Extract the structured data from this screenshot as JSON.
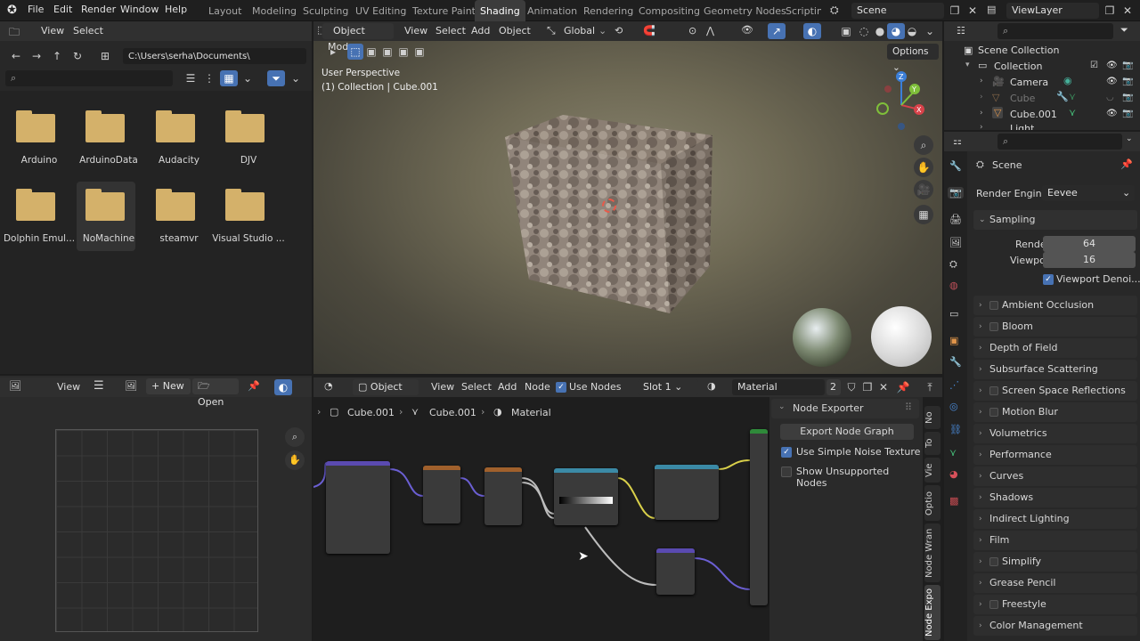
{
  "topbar": {
    "menus": [
      "File",
      "Edit",
      "Render",
      "Window",
      "Help"
    ],
    "workspaces": [
      "Layout",
      "Modeling",
      "Sculpting",
      "UV Editing",
      "Texture Paint",
      "Shading",
      "Animation",
      "Rendering",
      "Compositing",
      "Geometry Nodes",
      "Scripting"
    ],
    "active_workspace": "Shading",
    "scene": "Scene",
    "view_layer": "ViewLayer"
  },
  "file_browser": {
    "menus": [
      "View",
      "Select"
    ],
    "path": "C:\\Users\\serha\\Documents\\",
    "folders": [
      "Arduino",
      "ArduinoData",
      "Audacity",
      "DJV",
      "Dolphin Emul...",
      "NoMachine",
      "steamvr",
      "Visual Studio ..."
    ],
    "selected_folder": "NoMachine"
  },
  "viewport": {
    "mode": "Object Mode",
    "menus": [
      "View",
      "Select",
      "Add",
      "Object"
    ],
    "orientation": "Global",
    "options": "Options",
    "overlay_title": "User Perspective",
    "overlay_subtitle": "(1) Collection | Cube.001"
  },
  "image_editor": {
    "view": "View",
    "new": "New",
    "open": "Open"
  },
  "node_editor": {
    "object": "Object",
    "menus": [
      "View",
      "Select",
      "Add",
      "Node"
    ],
    "use_nodes": "Use Nodes",
    "slot": "Slot 1",
    "material": "Material",
    "users": "2",
    "breadcrumb": [
      "Cube.001",
      "Cube.001",
      "Material"
    ],
    "exporter": {
      "title": "Node Exporter",
      "export_button": "Export Node Graph",
      "simple_noise": "Use Simple Noise Texture",
      "show_unsupported": "Show Unsupported Nodes"
    },
    "side_tabs": [
      "No",
      "To",
      "Vie",
      "Optio",
      "Node Wran",
      "Node Expo"
    ]
  },
  "outliner": {
    "root": "Scene Collection",
    "collection": "Collection",
    "items": [
      "Camera",
      "Cube",
      "Cube.001",
      "Light"
    ]
  },
  "properties": {
    "scene": "Scene",
    "render_engine_label": "Render Engine",
    "render_engine": "Eevee",
    "sampling": "Sampling",
    "render_label": "Render",
    "render_value": "64",
    "viewport_label": "Viewport",
    "viewport_value": "16",
    "viewport_denoise": "Viewport Denoi...",
    "panels": [
      "Ambient Occlusion",
      "Bloom",
      "Depth of Field",
      "Subsurface Scattering",
      "Screen Space Reflections",
      "Motion Blur",
      "Volumetrics",
      "Performance",
      "Curves",
      "Shadows",
      "Indirect Lighting",
      "Film",
      "Simplify",
      "Grease Pencil",
      "Freestyle",
      "Color Management"
    ],
    "checkbox_panels": [
      "Ambient Occlusion",
      "Bloom",
      "Screen Space Reflections",
      "Motion Blur",
      "Simplify",
      "Freestyle"
    ]
  },
  "colors": {
    "accent": "#4772b3",
    "folder": "#d4b16a",
    "panel_bg": "#303030"
  }
}
